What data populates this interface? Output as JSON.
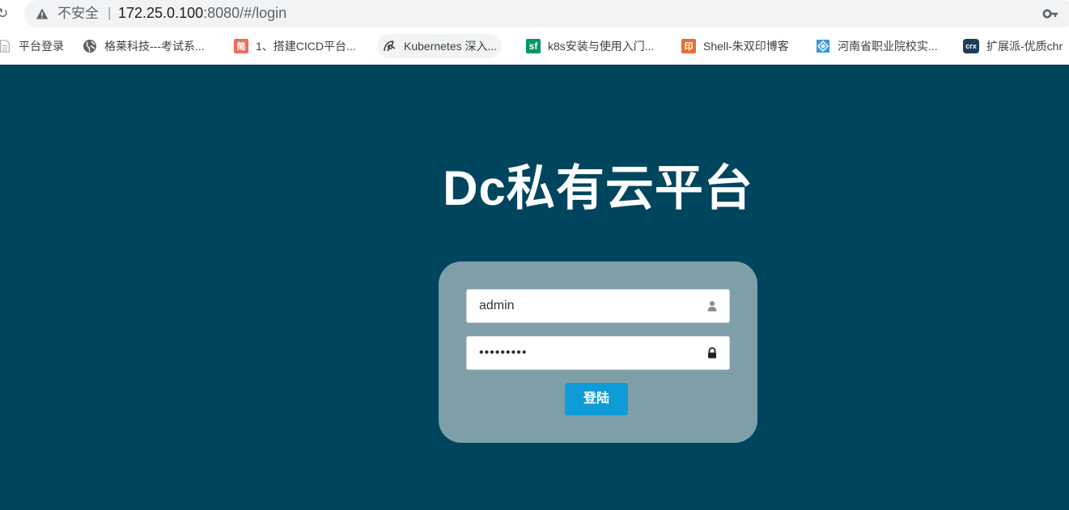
{
  "browser": {
    "security_text": "不安全",
    "separator": "|",
    "url_host": "172.25.0.100",
    "url_rest": ":8080/#/login",
    "icons": {
      "reload": "reload-icon",
      "warning": "warning-icon",
      "key": "key-icon"
    }
  },
  "bookmarks": [
    {
      "label": "平台登录",
      "icon": "document-icon"
    },
    {
      "label": "格莱科技---考试系...",
      "icon": "globe-icon"
    },
    {
      "label": "1、搭建CICD平台...",
      "icon": "jianshu-icon",
      "icon_text": "简",
      "color": "#ea6f5a"
    },
    {
      "label": "Kubernetes 深入...",
      "icon": "kubernetes-icon"
    },
    {
      "label": "k8s安装与使用入门...",
      "icon": "segmentfault-icon",
      "icon_text": "sf",
      "color": "#009a61"
    },
    {
      "label": "Shell-朱双印博客",
      "icon": "zsythink-icon",
      "icon_text": "印",
      "color": "#e8702a"
    },
    {
      "label": "河南省职业院校实...",
      "icon": "school-icon"
    },
    {
      "label": "扩展派-优质chr",
      "icon": "crx-icon",
      "icon_text": "crx",
      "color": "#1c3d5a"
    }
  ],
  "page": {
    "title": "Dc私有云平台",
    "background_color": "#00455e",
    "card_color": "#7f9fa8",
    "accent_color": "#0e9bd8"
  },
  "login": {
    "username_value": "admin",
    "password_value": "•••••••••",
    "submit_label": "登陆",
    "icons": {
      "username": "user-icon",
      "password": "lock-icon"
    }
  }
}
